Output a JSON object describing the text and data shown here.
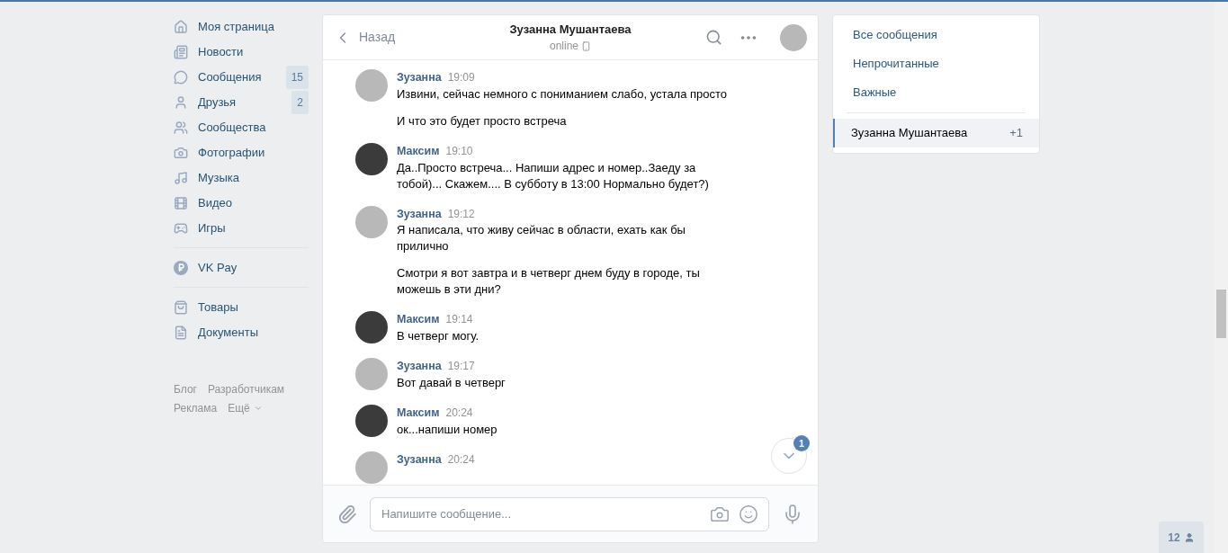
{
  "sidebar": {
    "sections": [
      [
        {
          "label": "Моя страница"
        },
        {
          "label": "Новости"
        },
        {
          "label": "Сообщения",
          "badge": "15"
        },
        {
          "label": "Друзья",
          "badge": "2"
        },
        {
          "label": "Сообщества"
        },
        {
          "label": "Фотографии"
        },
        {
          "label": "Музыка"
        },
        {
          "label": "Видео"
        },
        {
          "label": "Игры"
        }
      ],
      [
        {
          "label": "VK Pay"
        }
      ],
      [
        {
          "label": "Товары"
        },
        {
          "label": "Документы"
        }
      ]
    ],
    "footer_links": [
      [
        "Блог",
        "Разработчикам"
      ],
      [
        "Реклама",
        "Ещё"
      ]
    ]
  },
  "chat": {
    "back": "Назад",
    "title": "Зузанна Мушантаева",
    "status": "online",
    "messages": [
      {
        "author": "Зузанна",
        "time": "19:09",
        "paragraphs": [
          "Извини, сейчас немного с пониманием слабо, устала просто",
          "И что это будет просто встреча"
        ]
      },
      {
        "author": "Максим",
        "time": "19:10",
        "paragraphs": [
          "Да..Просто встреча... Напиши адрес и номер..Заеду за тобой)... Скажем.... В субботу в 13:00 Нормально будет?)"
        ]
      },
      {
        "author": "Зузанна",
        "time": "19:12",
        "paragraphs": [
          "Я написала, что живу сейчас в области, ехать как бы прилично",
          "Смотри я вот завтра и в четверг днем буду в городе, ты можешь в эти дни?"
        ]
      },
      {
        "author": "Максим",
        "time": "19:14",
        "paragraphs": [
          "В четверг могу."
        ]
      },
      {
        "author": "Зузанна",
        "time": "19:17",
        "paragraphs": [
          "Вот давай в четверг"
        ]
      },
      {
        "author": "Максим",
        "time": "20:24",
        "paragraphs": [
          "ок...напиши номер"
        ]
      },
      {
        "author": "Зузанна",
        "time": "20:24"
      }
    ],
    "scroll_down_badge": "1",
    "composer": {
      "placeholder": "Напишите сообщение..."
    }
  },
  "right_panel": {
    "filters": [
      {
        "label": "Все сообщения",
        "selected": false
      },
      {
        "label": "Непрочитанные",
        "selected": false
      },
      {
        "label": "Важные",
        "selected": false
      }
    ],
    "conversations": [
      {
        "name": "Зузанна Мушантаева",
        "count": "+1",
        "selected": true
      }
    ]
  },
  "friends_online": {
    "count": "12"
  }
}
